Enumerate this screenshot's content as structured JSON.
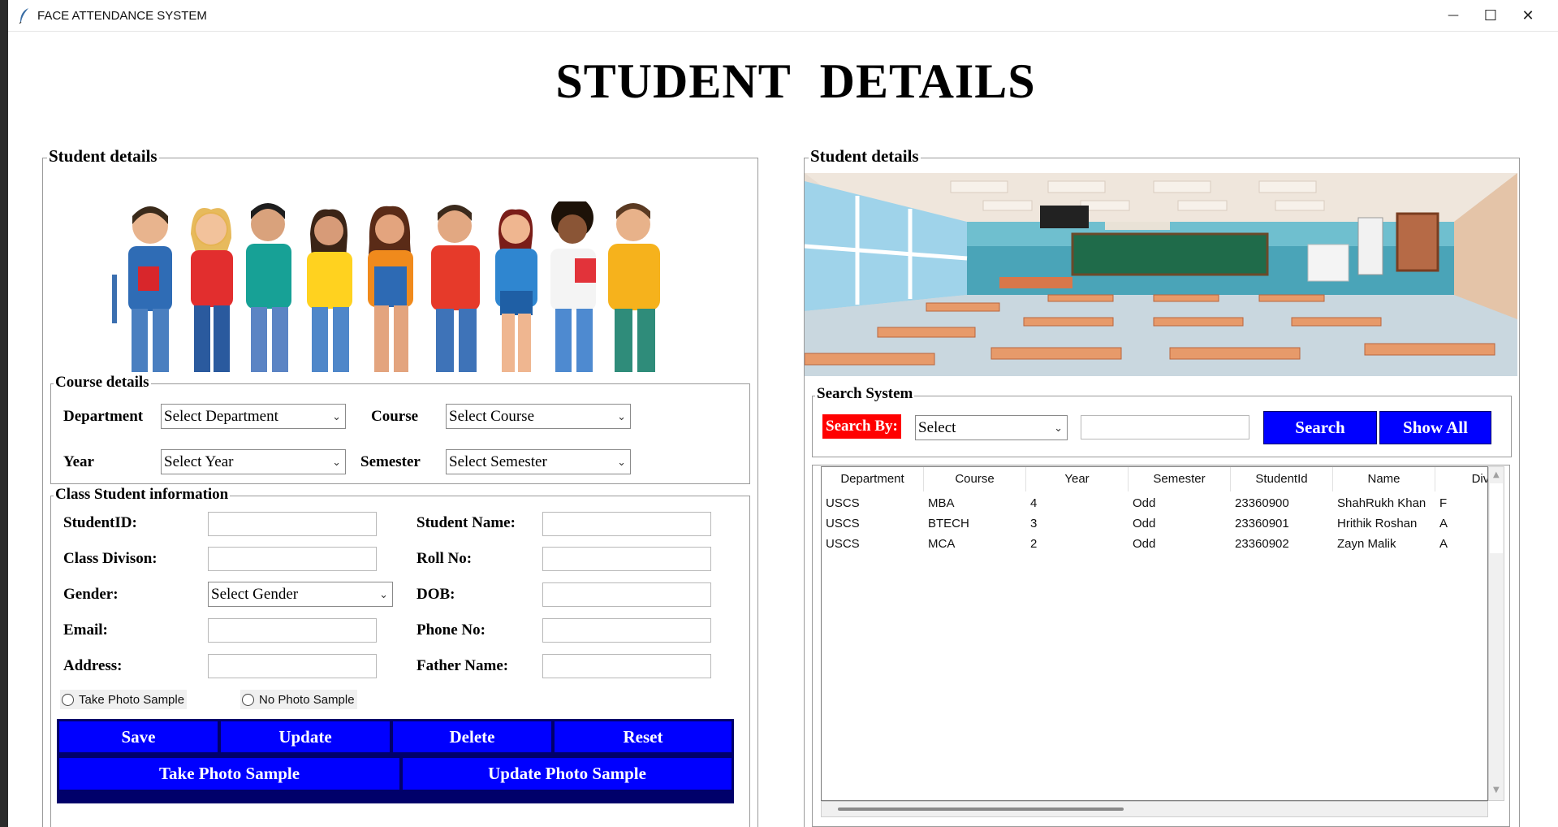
{
  "window": {
    "title": "FACE ATTENDANCE SYSTEM",
    "minimize_glyph": "—",
    "maximize_glyph": "☐",
    "close_glyph": "✕"
  },
  "heading": "STUDENT  DETAILS",
  "left_panel": {
    "legend": "Student details",
    "course": {
      "legend": "Course details",
      "department_label": "Department",
      "department_value": "Select Department",
      "course_label": "Course",
      "course_value": "Select Course",
      "year_label": "Year",
      "year_value": "Select Year",
      "semester_label": "Semester",
      "semester_value": "Select Semester"
    },
    "class_info": {
      "legend": "Class Student information",
      "student_id_label": "StudentID:",
      "student_name_label": "Student Name:",
      "class_division_label": "Class Divison:",
      "roll_no_label": "Roll No:",
      "gender_label": "Gender:",
      "gender_value": "Select Gender",
      "dob_label": "DOB:",
      "email_label": "Email:",
      "phone_label": "Phone No:",
      "address_label": "Address:",
      "father_name_label": "Father Name:",
      "radio_take": "Take Photo Sample",
      "radio_no": "No Photo Sample",
      "buttons": {
        "save": "Save",
        "update": "Update",
        "delete": "Delete",
        "reset": "Reset",
        "take_photo": "Take Photo Sample",
        "update_photo": "Update Photo Sample"
      }
    }
  },
  "right_panel": {
    "legend": "Student details",
    "search": {
      "legend": "Search System",
      "search_by_label": "Search By:",
      "combo_value": "Select",
      "search_button": "Search",
      "show_all_button": "Show All"
    },
    "table": {
      "columns": [
        "Department",
        "Course",
        "Year",
        "Semester",
        "StudentId",
        "Name",
        "Divisi"
      ],
      "rows": [
        [
          "USCS",
          "MBA",
          "4",
          "Odd",
          "23360900",
          "ShahRukh Khan",
          "F"
        ],
        [
          "USCS",
          "BTECH",
          "3",
          "Odd",
          "23360901",
          "Hrithik Roshan",
          "A"
        ],
        [
          "USCS",
          "MCA",
          "2",
          "Odd",
          "23360902",
          "Zayn Malik",
          "A"
        ]
      ]
    }
  },
  "colors": {
    "button_blue": "#0000ff",
    "search_label_red": "#ff0000",
    "frame_border": "#9a9a9a"
  }
}
